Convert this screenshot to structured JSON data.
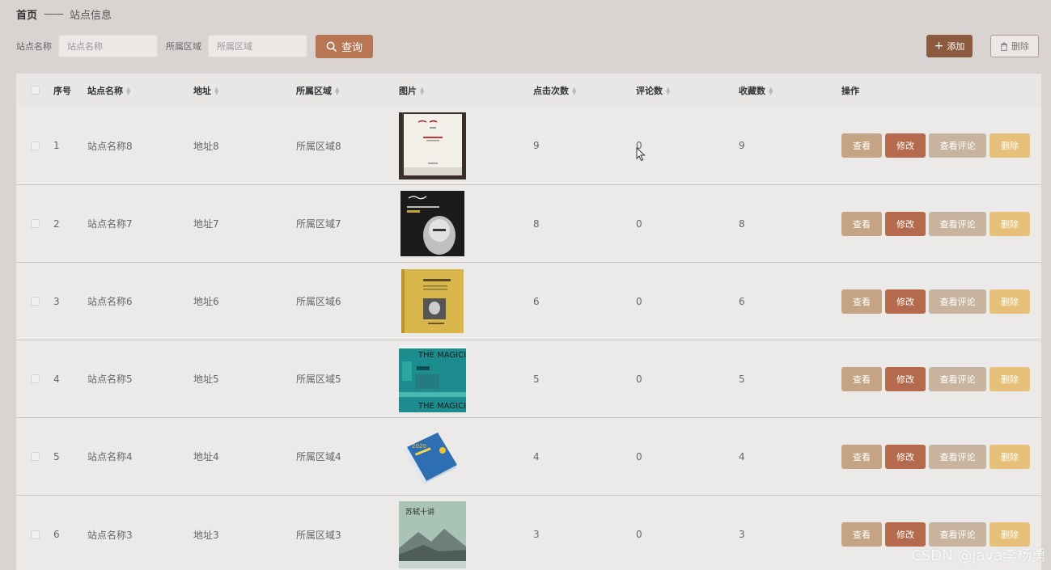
{
  "breadcrumb": {
    "home": "首页",
    "separator": "——",
    "current": "站点信息"
  },
  "search": {
    "name_label": "站点名称",
    "name_placeholder": "站点名称",
    "region_label": "所属区域",
    "region_placeholder": "所属区域",
    "query_label": "查询"
  },
  "toolbar": {
    "add_label": "添加",
    "delete_label": "删除"
  },
  "table": {
    "headers": {
      "index": "序号",
      "name": "站点名称",
      "address": "地址",
      "region": "所属区域",
      "image": "图片",
      "clicks": "点击次数",
      "comments": "评论数",
      "favorites": "收藏数",
      "operations": "操作"
    },
    "rows": [
      {
        "index": "1",
        "name": "站点名称8",
        "address": "地址8",
        "region": "所属区域8",
        "clicks": "9",
        "comments": "0",
        "favorites": "9",
        "cover": "book-cover-1"
      },
      {
        "index": "2",
        "name": "站点名称7",
        "address": "地址7",
        "region": "所属区域7",
        "clicks": "8",
        "comments": "0",
        "favorites": "8",
        "cover": "book-cover-2"
      },
      {
        "index": "3",
        "name": "站点名称6",
        "address": "地址6",
        "region": "所属区域6",
        "clicks": "6",
        "comments": "0",
        "favorites": "6",
        "cover": "book-cover-3"
      },
      {
        "index": "4",
        "name": "站点名称5",
        "address": "地址5",
        "region": "所属区域5",
        "clicks": "5",
        "comments": "0",
        "favorites": "5",
        "cover": "book-cover-4"
      },
      {
        "index": "5",
        "name": "站点名称4",
        "address": "地址4",
        "region": "所属区域4",
        "clicks": "4",
        "comments": "0",
        "favorites": "4",
        "cover": "book-cover-5"
      },
      {
        "index": "6",
        "name": "站点名称3",
        "address": "地址3",
        "region": "所属区域3",
        "clicks": "3",
        "comments": "0",
        "favorites": "3",
        "cover": "book-cover-6"
      }
    ],
    "actions": {
      "view": "查看",
      "edit": "修改",
      "view_comments": "查看评论",
      "delete": "删除"
    }
  },
  "covers": {
    "c4_text_top": "THE MAGICIAN",
    "c4_text_bottom": "THE MAGICIAN",
    "c5_label": "2020",
    "c6_title": "苏轼十讲"
  },
  "watermark": "CSDN @java李杨勇",
  "colors": {
    "accent_dark": "#8c5a3f",
    "query": "#b87752",
    "view": "#c4a485",
    "edit": "#b56a4d",
    "view_comments": "#c8b49e",
    "delete": "#e6c079"
  }
}
